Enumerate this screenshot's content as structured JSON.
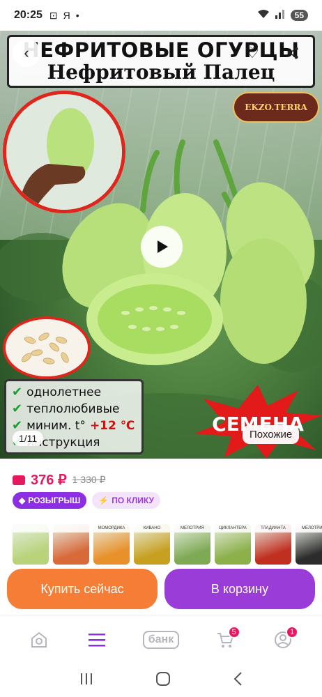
{
  "status_bar": {
    "time": "20:25",
    "letter": "Я",
    "battery": "55"
  },
  "hero": {
    "title_line1": "НЕФРИТОВЫЕ ОГУРЦЫ",
    "title_line2": "Нефритовый Палец",
    "brand": "EKZO.TERRA",
    "features": [
      "однолетнее",
      "теплолюбивые",
      "миним. t°",
      "инструкция"
    ],
    "temp_value": "+12 ℃",
    "semena_label": "СЕМЕНА",
    "image_counter": "1/11",
    "similar_button": "Похожие"
  },
  "price": {
    "current": "376 ₽",
    "old": "1 330 ₽"
  },
  "tags": {
    "raffle": "РОЗЫГРЫШ",
    "one_click": "ПО КЛИКУ"
  },
  "thumbnails": [
    {
      "label": "",
      "color": "#b8d37a"
    },
    {
      "label": "",
      "color": "#d86a3a"
    },
    {
      "label": "МОМОРДИКА",
      "color": "#e8902a"
    },
    {
      "label": "КИВАНО",
      "color": "#c8a020"
    },
    {
      "label": "МЕЛОТРИЯ",
      "color": "#7faa55"
    },
    {
      "label": "ЦИКЛАНТЕРА",
      "color": "#8cb04a"
    },
    {
      "label": "ТЛАДИАНТА",
      "color": "#c03020"
    },
    {
      "label": "МЕЛОТРИЯ",
      "color": "#2c2c2c"
    }
  ],
  "actions": {
    "buy_now": "Купить сейчас",
    "add_to_cart": "В корзину"
  },
  "bottom_nav": {
    "bank": "банк",
    "cart_badge": "5",
    "profile_badge": "1"
  },
  "colors": {
    "accent": "#9a3dd8",
    "price": "#e6195c",
    "buy": "#f57d35"
  }
}
